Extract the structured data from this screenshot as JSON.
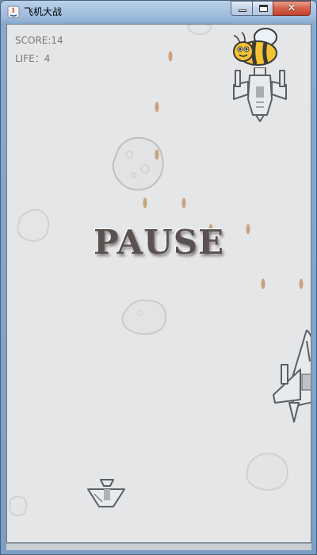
{
  "window": {
    "title": "飞机大战",
    "controls": [
      "minimize",
      "maximize",
      "close"
    ],
    "close_glyph": "✕"
  },
  "hud": {
    "score_label": "SCORE:14",
    "life_label": "LIFE：4"
  },
  "overlay": {
    "status": "PAUSE"
  },
  "icons": {
    "app": "app-java-icon",
    "enemy_bee": "bee-icon",
    "enemy_plane": "enemy-plane-icon",
    "hero_plane": "hero-plane-icon",
    "bullet": "bullet-icon",
    "asteroid": "asteroid-icon"
  },
  "colors": {
    "background": "#e4e6e8",
    "bullet": "#c9a27c",
    "pause_text": "#5a5250",
    "hud_text": "#777777"
  }
}
